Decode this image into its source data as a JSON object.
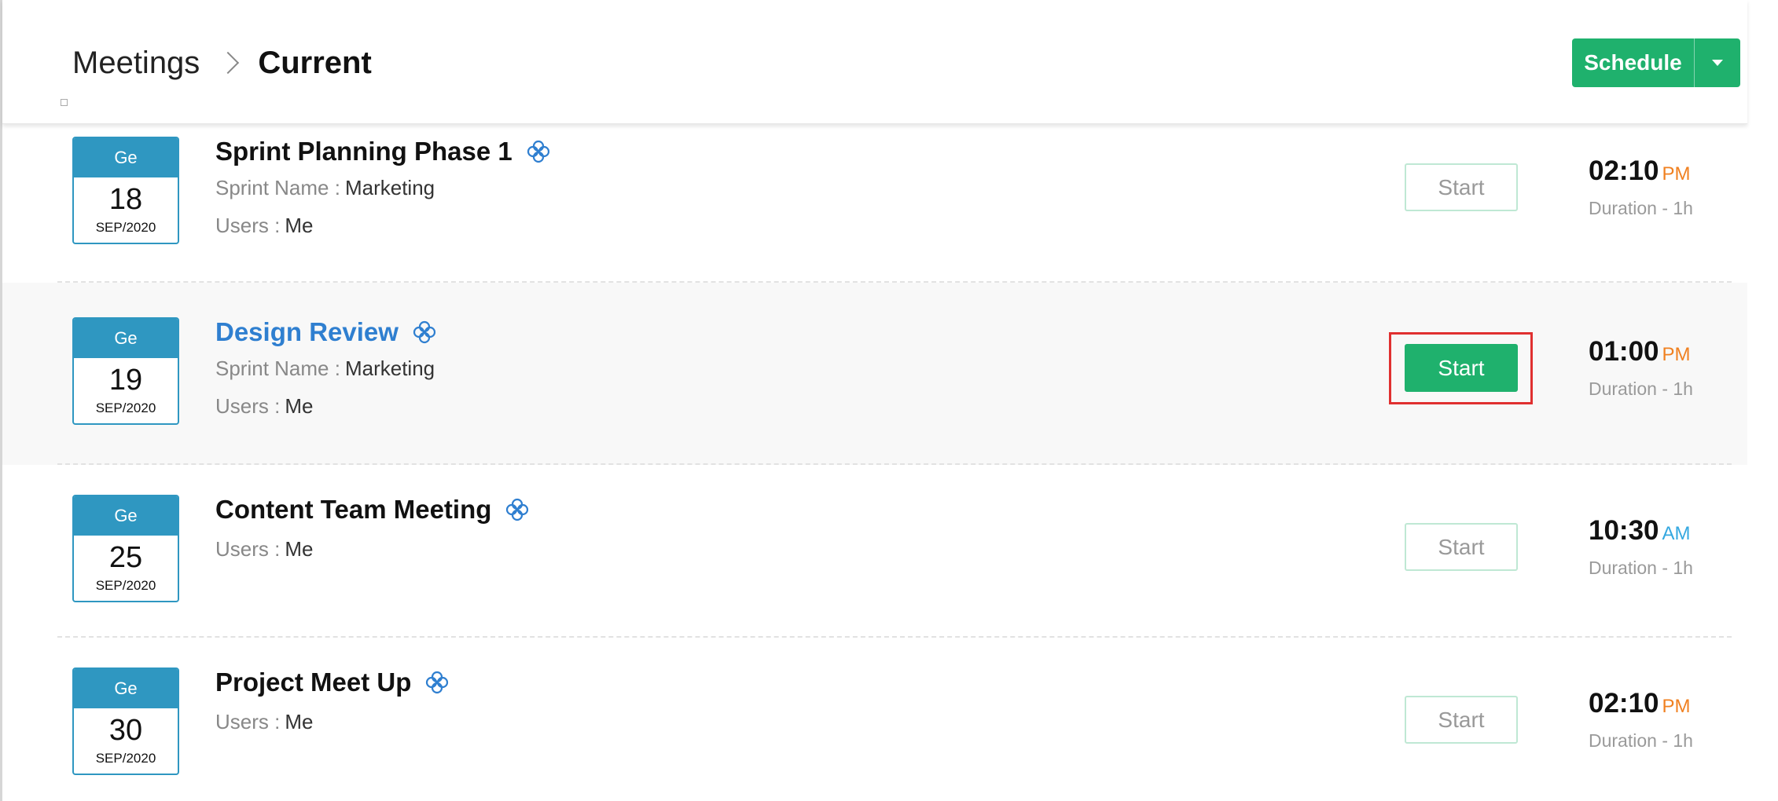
{
  "header": {
    "breadcrumb_root": "Meetings",
    "breadcrumb_current": "Current",
    "schedule_label": "Schedule"
  },
  "colors": {
    "accent_green": "#1fb16d",
    "date_blue": "#2f97c1",
    "link_blue": "#2f7fd0",
    "pm_orange": "#f08020",
    "am_blue": "#35a8e0",
    "highlight_red": "#e03030"
  },
  "meetings": [
    {
      "weekday": "Ge",
      "day": "18",
      "month_year": "SEP/2020",
      "title": "Sprint Planning Phase 1",
      "sprint_label": "Sprint Name :",
      "sprint_value": "Marketing",
      "users_label": "Users :",
      "users_value": "Me",
      "start_label": "Start",
      "time": "02:10",
      "ampm": "PM",
      "duration": "Duration - 1h"
    },
    {
      "weekday": "Ge",
      "day": "19",
      "month_year": "SEP/2020",
      "title": "Design Review",
      "sprint_label": "Sprint Name :",
      "sprint_value": "Marketing",
      "users_label": "Users :",
      "users_value": "Me",
      "start_label": "Start",
      "time": "01:00",
      "ampm": "PM",
      "duration": "Duration - 1h"
    },
    {
      "weekday": "Ge",
      "day": "25",
      "month_year": "SEP/2020",
      "title": "Content Team Meeting",
      "users_label": "Users :",
      "users_value": "Me",
      "start_label": "Start",
      "time": "10:30",
      "ampm": "AM",
      "duration": "Duration - 1h"
    },
    {
      "weekday": "Ge",
      "day": "30",
      "month_year": "SEP/2020",
      "title": "Project Meet Up",
      "users_label": "Users :",
      "users_value": "Me",
      "start_label": "Start",
      "time": "02:10",
      "ampm": "PM",
      "duration": "Duration - 1h"
    }
  ]
}
